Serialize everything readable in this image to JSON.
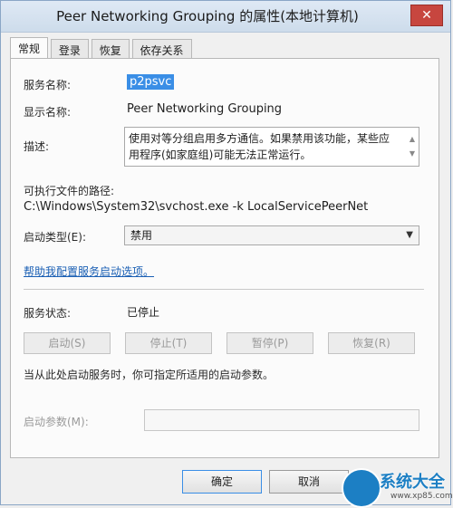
{
  "window": {
    "title": "Peer Networking Grouping 的属性(本地计算机)",
    "close_glyph": "✕"
  },
  "tabs": [
    {
      "label": "常规"
    },
    {
      "label": "登录"
    },
    {
      "label": "恢复"
    },
    {
      "label": "依存关系"
    }
  ],
  "general": {
    "service_name_label": "服务名称:",
    "service_name_value": "p2psvc",
    "display_name_label": "显示名称:",
    "display_name_value": "Peer Networking Grouping",
    "description_label": "描述:",
    "description_value": "使用对等分组启用多方通信。如果禁用该功能，某些应用程序(如家庭组)可能无法正常运行。",
    "exe_path_label": "可执行文件的路径:",
    "exe_path_value": "C:\\Windows\\System32\\svchost.exe -k LocalServicePeerNet",
    "startup_type_label": "启动类型(E):",
    "startup_type_value": "禁用",
    "help_link": "帮助我配置服务启动选项。",
    "service_status_label": "服务状态:",
    "service_status_value": "已停止",
    "start_button": "启动(S)",
    "stop_button": "停止(T)",
    "pause_button": "暂停(P)",
    "resume_button": "恢复(R)",
    "hint_text": "当从此处启动服务时，你可指定所适用的启动参数。",
    "start_params_label": "启动参数(M):",
    "start_params_value": ""
  },
  "footer": {
    "ok_button": "确定",
    "cancel_button": "取消"
  },
  "watermark": {
    "text": "系统大全",
    "url": "www.xp85.com"
  }
}
